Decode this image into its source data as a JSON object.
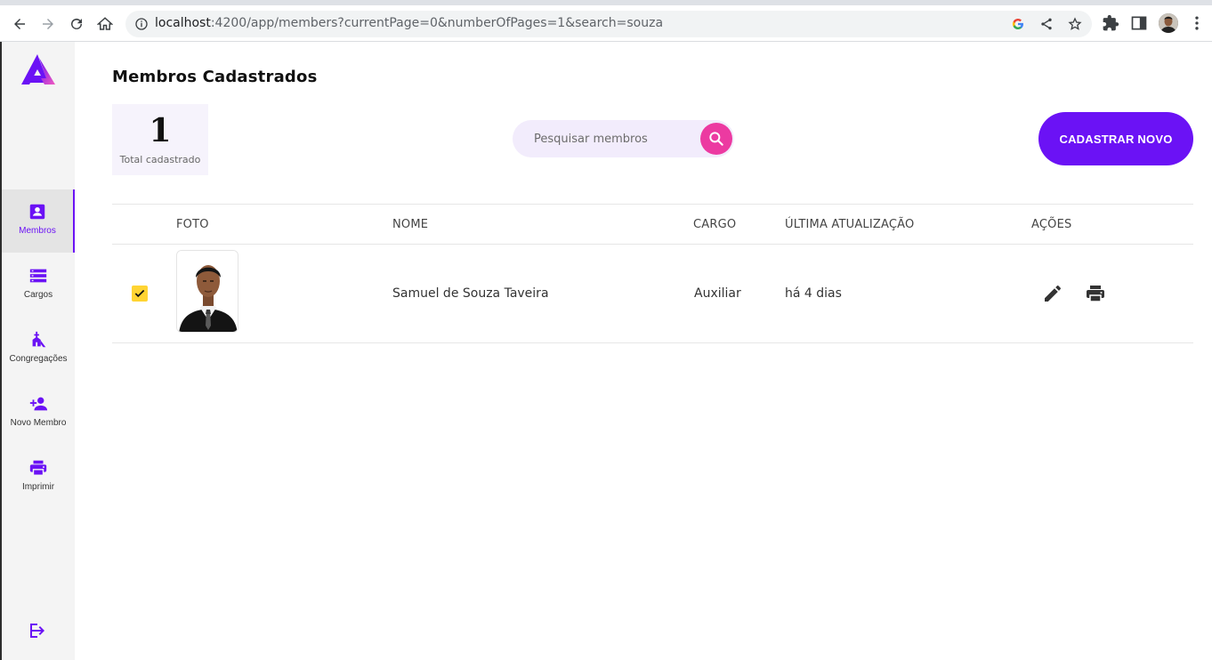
{
  "browser": {
    "url_host": "localhost",
    "url_rest": ":4200/app/members?currentPage=0&numberOfPages=1&search=souza"
  },
  "sidebar": {
    "items": [
      {
        "label": "Membros",
        "icon": "badge-icon",
        "active": true
      },
      {
        "label": "Cargos",
        "icon": "storage-icon",
        "active": false
      },
      {
        "label": "Congregações",
        "icon": "church-icon",
        "active": false
      },
      {
        "label": "Novo Membro",
        "icon": "person-add-icon",
        "active": false
      },
      {
        "label": "Imprimir",
        "icon": "print-icon",
        "active": false
      }
    ]
  },
  "main": {
    "title": "Membros Cadastrados",
    "stat": {
      "value": "1",
      "label": "Total cadastrado"
    },
    "search": {
      "placeholder": "Pesquisar membros",
      "value": ""
    },
    "cta_label": "CADASTRAR NOVO",
    "table": {
      "headers": [
        "FOTO",
        "NOME",
        "CARGO",
        "ÚLTIMA ATUALIZAÇÃO",
        "AÇÕES"
      ],
      "rows": [
        {
          "checked": true,
          "name": "Samuel de Souza Taveira",
          "role": "Auxiliar",
          "updated": "há 4 dias"
        }
      ]
    }
  },
  "colors": {
    "accent": "#6b12f5",
    "search_button": "#ec3aa1",
    "checkbox": "#ffd433"
  }
}
